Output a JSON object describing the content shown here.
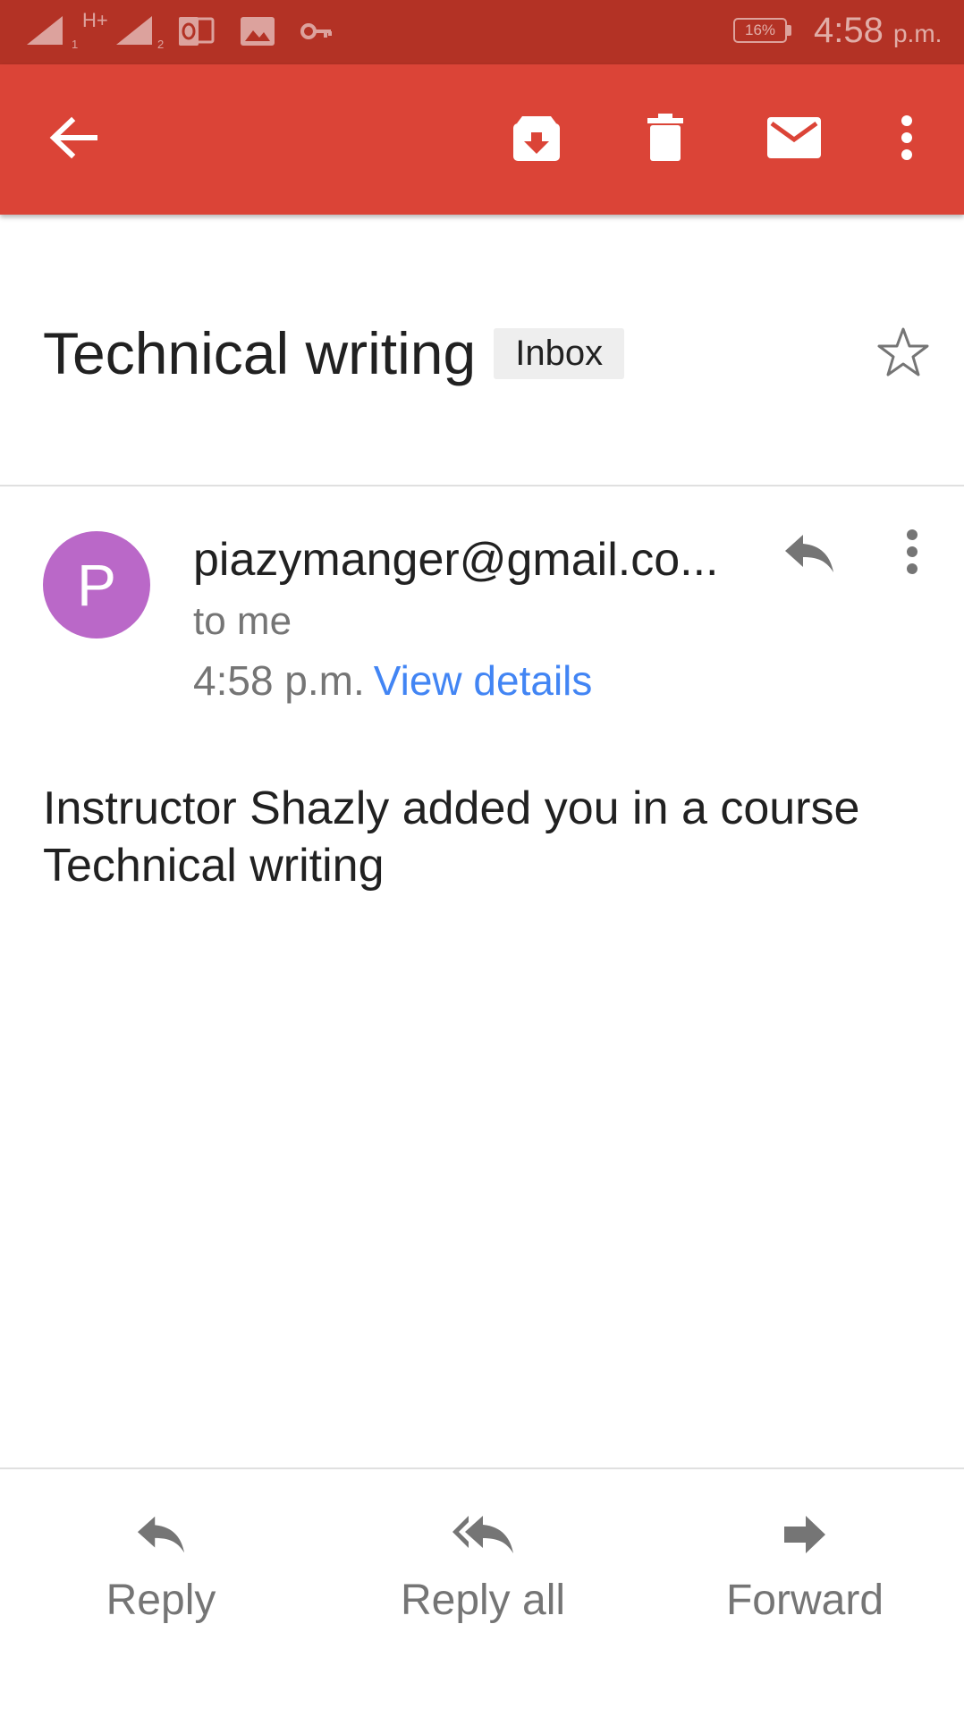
{
  "status_bar": {
    "network_type": "H+",
    "sim1_index": "1",
    "sim2_index": "2",
    "battery_percent": "16%",
    "time": "4:58",
    "ampm": "p.m.",
    "icons": [
      "signal-icon",
      "signal-icon",
      "outlook-icon",
      "image-icon",
      "key-icon",
      "battery-icon"
    ]
  },
  "toolbar": {
    "icons": [
      "back-arrow-icon",
      "archive-icon",
      "delete-icon",
      "mail-icon",
      "more-vert-icon"
    ]
  },
  "email": {
    "subject": "Technical writing",
    "label": "Inbox",
    "sender_initial": "P",
    "sender": "piazymanger@gmail.co...",
    "recipient": "to me",
    "time": "4:58 p.m.",
    "view_details": "View details",
    "body_line1": "Instructor Shazly added you in a course",
    "body_line2": "Technical writing"
  },
  "actions": {
    "reply": "Reply",
    "reply_all": "Reply all",
    "forward": "Forward"
  },
  "colors": {
    "status_bar": "#B33225",
    "toolbar": "#DB4437",
    "avatar": "#BA68C8",
    "link": "#4285F4",
    "label_chip": "#EEEEEE"
  }
}
